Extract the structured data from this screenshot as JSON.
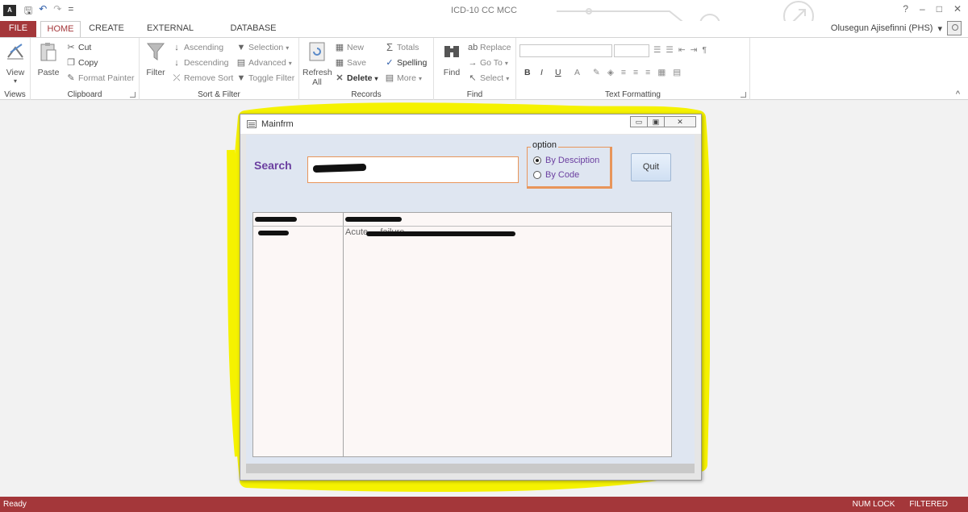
{
  "window": {
    "title": "ICD-10 CC MCC",
    "minimize": "–",
    "restore": "□",
    "close": "✕",
    "help": "?"
  },
  "qat": {
    "save_glyph": "🖫",
    "undo_glyph": "↶",
    "redo_glyph": "↷",
    "customize_glyph": "="
  },
  "app_logo": "A",
  "user": {
    "name": "Olusegun Ajisefinni (PHS)",
    "dropdown": "▾"
  },
  "tabs": {
    "file": "FILE",
    "home": "HOME",
    "create": "CREATE",
    "external": "EXTERNAL DATA",
    "dbtools": "DATABASE TOOLS"
  },
  "ribbon": {
    "views": {
      "view": "View",
      "label": "Views",
      "arrow": "▾"
    },
    "clipboard": {
      "paste": "Paste",
      "cut": "Cut",
      "copy": "Copy",
      "format_painter": "Format Painter",
      "label": "Clipboard"
    },
    "sortfilter": {
      "filter": "Filter",
      "ascending": "Ascending",
      "descending": "Descending",
      "remove_sort": "Remove Sort",
      "selection": "Selection",
      "advanced": "Advanced",
      "toggle_filter": "Toggle Filter",
      "label": "Sort & Filter"
    },
    "records": {
      "refresh": "Refresh",
      "refresh_all": "All",
      "new": "New",
      "save": "Save",
      "delete": "Delete",
      "totals": "Totals",
      "spelling": "Spelling",
      "more": "More",
      "label": "Records"
    },
    "find": {
      "find": "Find",
      "replace": "Replace",
      "goto": "Go To",
      "select": "Select",
      "label": "Find"
    },
    "text_formatting": {
      "bold": "B",
      "italic": "I",
      "underline": "U",
      "font_color": "A",
      "label": "Text Formatting"
    },
    "collapse": "^"
  },
  "form": {
    "title": "Mainfrm",
    "search_label": "Search",
    "option_legend": "option",
    "option_by_description": "By Desciption",
    "option_by_code": "By Code",
    "option_selected": "By Desciption",
    "quit": "Quit",
    "list_row1_col2": "Acute ... failure"
  },
  "status": {
    "ready": "Ready",
    "num_lock": "NUM LOCK",
    "filtered": "FILTERED"
  },
  "colors": {
    "accent": "#a4373a",
    "highlight": "#f5f200",
    "form_bg": "#dfe6f1",
    "label_purple": "#6b3fa0",
    "field_border": "#e8955a"
  }
}
